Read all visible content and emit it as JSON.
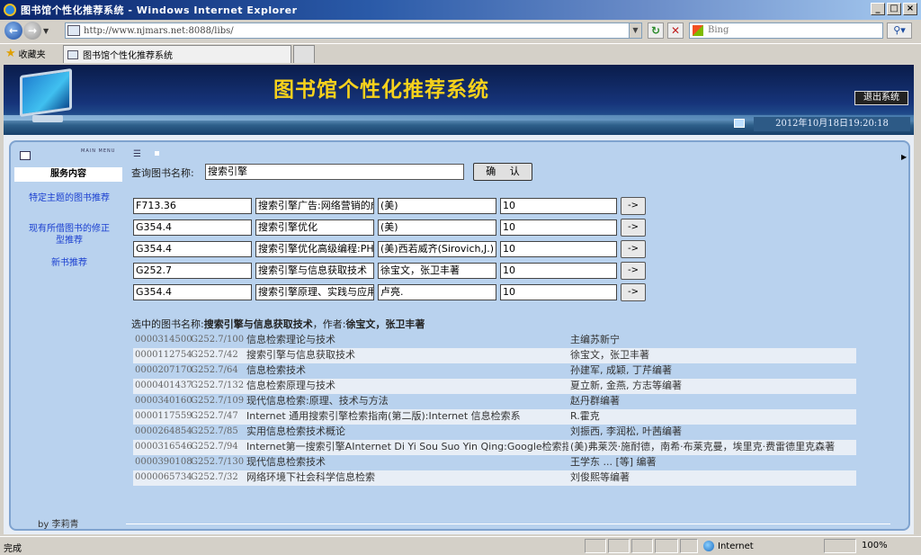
{
  "browser": {
    "window_title": "图书馆个性化推荐系统 - Windows Internet Explorer",
    "address": "http://www.njmars.net:8088/libs/",
    "search_placeholder": "Bing",
    "favorites_label": "收藏夹",
    "tab_title": "图书馆个性化推荐系统",
    "status_text": "完成",
    "zone_text": "Internet",
    "zoom_text": "100%"
  },
  "header": {
    "site_title": "图书馆个性化推荐系统",
    "logout_label": "退出系统",
    "datetime": "2012年10月18日19:20:18"
  },
  "sidebar": {
    "main_menu_label": "MAIN MENU",
    "section_title": "服务内容",
    "items": [
      {
        "label": "特定主题的图书推荐"
      },
      {
        "label": "现有所借图书的修正型推荐"
      },
      {
        "label": "新书推荐"
      }
    ],
    "byline": "by 李莉青"
  },
  "query": {
    "label": "查询图书名称:",
    "value": "搜索引擎",
    "confirm_label": "确 认"
  },
  "results": [
    {
      "call_no": "F713.36",
      "title": "搜索引擎广告:网络营销的成功之路",
      "author": "(美)",
      "count": "10",
      "go": "->"
    },
    {
      "call_no": "G354.4",
      "title": "搜索引擎优化",
      "author": "(美)",
      "count": "10",
      "go": "->"
    },
    {
      "call_no": "G354.4",
      "title": "搜索引擎优化高级编程:PHP版",
      "author": "(美)西若威齐(Sirovich,J.)",
      "count": "10",
      "go": "->"
    },
    {
      "call_no": "G252.7",
      "title": "搜索引擎与信息获取技术",
      "author": "徐宝文，张卫丰著",
      "count": "10",
      "go": "->"
    },
    {
      "call_no": "G354.4",
      "title": "搜索引擎原理、实践与应用",
      "author": "卢亮.",
      "count": "10",
      "go": "->"
    }
  ],
  "selected": {
    "prefix": "选中的图书名称:",
    "title": "搜索引擎与信息获取技术",
    "sep": "，作者:",
    "author": "徐宝文，张卫丰著"
  },
  "related": [
    {
      "id": "0000314500",
      "call": "G252.7/100",
      "title": "信息检索理论与技术",
      "author": "主编苏新宁"
    },
    {
      "id": "0000112754",
      "call": "G252.7/42",
      "title": "搜索引擎与信息获取技术",
      "author": "徐宝文，张卫丰著"
    },
    {
      "id": "0000207170",
      "call": "G252.7/64",
      "title": "信息检索技术",
      "author": "孙建军, 成颖, 丁芹编著"
    },
    {
      "id": "0000401437",
      "call": "G252.7/132",
      "title": "信息检索原理与技术",
      "author": "夏立新, 金燕, 方志等编著"
    },
    {
      "id": "0000340160",
      "call": "G252.7/109",
      "title": "现代信息检索:原理、技术与方法",
      "author": "赵丹群编著"
    },
    {
      "id": "0000117559",
      "call": "G252.7/47",
      "title": "Internet 通用搜索引擎检索指南(第二版):Internet 信息检索系",
      "author": "R.霍克"
    },
    {
      "id": "0000264854",
      "call": "G252.7/85",
      "title": "实用信息检索技术概论",
      "author": "刘振西, 李润松, 叶茜编著"
    },
    {
      "id": "0000316546",
      "call": "G252.7/94",
      "title": "Internet第一搜索引擎AInternet Di Yi Sou Suo Yin Qing:Google检索指南",
      "author": "(美)弗莱茨·施耐德，南希·布莱克曼，埃里克·费雷德里克森著"
    },
    {
      "id": "0000390108",
      "call": "G252.7/130",
      "title": "现代信息检索技术",
      "author": "王学东 ... [等] 编著"
    },
    {
      "id": "0000065734",
      "call": "G252.7/32",
      "title": "网络环境下社会科学信息检索",
      "author": "刘俊熙等编著"
    }
  ]
}
